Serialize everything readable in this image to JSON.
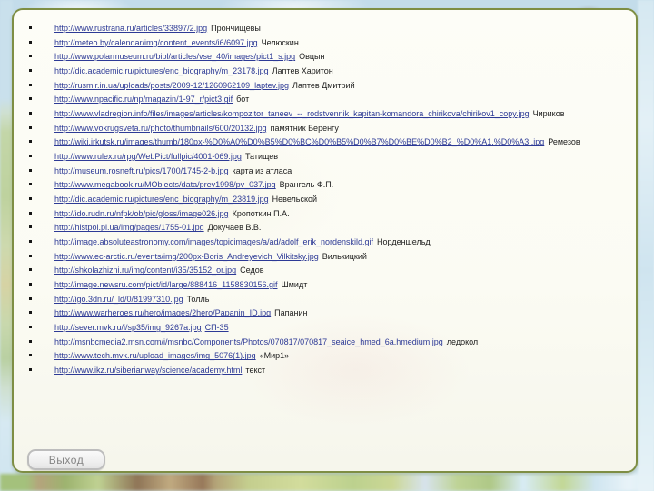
{
  "slide_type": "references-links-slide",
  "panel": {
    "border_color": "#7e8e44",
    "background_color": "#fbfbf3"
  },
  "list": {
    "bullet_icon": "square-bullet",
    "link_color": "#2d3a96",
    "label_color": "#1c1c1c",
    "items": [
      {
        "url": "http://www.rustrana.ru/articles/33897/2.jpg",
        "label": "Прончищевы",
        "label_linked": false
      },
      {
        "url": "http://meteo.by/calendar/img/content_events/i6/6097.jpg",
        "label": "Челюскин",
        "label_linked": false
      },
      {
        "url": "http://www.polarmuseum.ru/bibl/articles/vse_40/images/pict1_s.jpg",
        "label": "Овцын",
        "label_linked": false
      },
      {
        "url": "http://dic.academic.ru/pictures/enc_biography/m_23178.jpg",
        "label": "Лаптев Харитон",
        "label_linked": false
      },
      {
        "url": "http://rusmir.in.ua/uploads/posts/2009-12/1260962109_laptev.jpg",
        "label": "Лаптев  Дмитрий",
        "label_linked": false
      },
      {
        "url": "http://www.npacific.ru/np/magazin/1-97_r/pict3.gif",
        "label": "бот",
        "label_linked": false
      },
      {
        "url": "http://www.vladregion.info/files/images/articles/kompozitor_taneev_--_rodstvennik_kapitan-komandora_chirikova/chirikov1_copy.jpg",
        "label": "Чириков",
        "label_linked": false
      },
      {
        "url": "http://www.vokrugsveta.ru/photo/thumbnails/600/20132.jpg",
        "label": "памятник Беренгу",
        "label_linked": false
      },
      {
        "url": "http://wiki.irkutsk.ru/images/thumb/180px-%D0%A0%D0%B5%D0%BC%D0%B5%D0%B7%D0%BE%D0%B2_%D0%A1.%D0%A3..jpg",
        "label": "Ремезов",
        "label_linked": false
      },
      {
        "url": "http://www.rulex.ru/rpg/WebPict/fullpic/4001-069.jpg",
        "label": "Татищев",
        "label_linked": false
      },
      {
        "url": "http://museum.rosneft.ru/pics/1700/1745-2-b.jpg",
        "label": "карта из атласа",
        "label_linked": false
      },
      {
        "url": "http://www.megabook.ru/MObjects/data/prev1998/pv_037.jpg",
        "label": "Врангель Ф.П.",
        "label_linked": false
      },
      {
        "url": "http://dic.academic.ru/pictures/enc_biography/m_23819.jpg",
        "label": "Невельской",
        "label_linked": false
      },
      {
        "url": "http://ido.rudn.ru/nfpk/ob/pic/gloss/image026.jpg",
        "label": "Кропоткин П.А.",
        "label_linked": false
      },
      {
        "url": "http://histpol.pl.ua/img/pages/1755-01.jpg",
        "label": "Докучаев В.В.",
        "label_linked": false
      },
      {
        "url": "http://image.absoluteastronomy.com/images/topicimages/a/ad/adolf_erik_nordenskild.gif",
        "label": "Норденшельд",
        "label_linked": false
      },
      {
        "url": "http://www.ec-arctic.ru/events/img/200px-Boris_Andreyevich_Vilkitsky.jpg",
        "label": "Вилькицкий",
        "label_linked": false
      },
      {
        "url": "http://shkolazhizni.ru/img/content/i35/35152_or.jpg",
        "label": "Седов",
        "label_linked": false
      },
      {
        "url": "http://image.newsru.com/pict/id/large/888416_1158830156.gif",
        "label": "Шмидт",
        "label_linked": false
      },
      {
        "url": "http://igo.3dn.ru/_ld/0/81997310.jpg",
        "label": "Толль",
        "label_linked": false
      },
      {
        "url": "http://www.warheroes.ru/hero/images/2hero/Papanin_ID.jpg",
        "label": "Папанин",
        "label_linked": false
      },
      {
        "url": "http://sever.mvk.ru/i/sp35/img_9267a.jpg",
        "label": "СП-35",
        "label_linked": true
      },
      {
        "url": "http://msnbcmedia2.msn.com/i/msnbc/Components/Photos/070817/070817_seaice_hmed_6a.hmedium.jpg",
        "label": "ледокол",
        "label_linked": false
      },
      {
        "url": "http://www.tech.mvk.ru/upload_images/img_5076(1).jpg",
        "label": "«Мир1»",
        "label_linked": false
      },
      {
        "url": "http://www.ikz.ru/siberianway/science/academy.html",
        "label": "текст",
        "label_linked": false
      }
    ]
  },
  "exit_button": {
    "label": "Выход",
    "text_color": "#858585",
    "border_color": "#bdbdbd"
  }
}
